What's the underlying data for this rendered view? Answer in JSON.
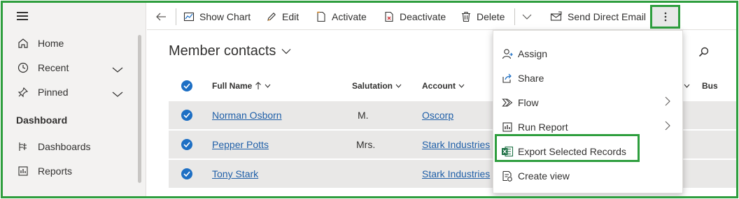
{
  "sidebar": {
    "items": [
      {
        "label": "Home",
        "icon": "home-icon"
      },
      {
        "label": "Recent",
        "icon": "clock-icon"
      },
      {
        "label": "Pinned",
        "icon": "pin-icon"
      }
    ],
    "section_title": "Dashboard",
    "section_items": [
      {
        "label": "Dashboards",
        "icon": "dashboards-icon"
      },
      {
        "label": "Reports",
        "icon": "reports-icon"
      }
    ]
  },
  "toolbar": {
    "show_chart": "Show Chart",
    "edit": "Edit",
    "activate": "Activate",
    "deactivate": "Deactivate",
    "delete": "Delete",
    "send_direct_email": "Send Direct Email"
  },
  "view": {
    "title": "Member contacts"
  },
  "grid": {
    "columns": [
      "Full Name",
      "Salutation",
      "Account",
      "Bus"
    ],
    "rows": [
      {
        "full_name": "Norman Osborn",
        "salutation": "M.",
        "account": "Oscorp"
      },
      {
        "full_name": "Pepper Potts",
        "salutation": "Mrs.",
        "account": "Stark Industries"
      },
      {
        "full_name": "Tony Stark",
        "salutation": "",
        "account": "Stark Industries"
      }
    ]
  },
  "menu": {
    "items": [
      {
        "label": "Assign",
        "icon": "person-icon"
      },
      {
        "label": "Share",
        "icon": "share-icon"
      },
      {
        "label": "Flow",
        "icon": "flow-icon"
      },
      {
        "label": "Run Report",
        "icon": "report-icon"
      },
      {
        "label": "Export Selected Records",
        "icon": "excel-icon"
      },
      {
        "label": "Create view",
        "icon": "create-view-icon"
      }
    ]
  },
  "colors": {
    "accent": "#1d6fc4",
    "highlight": "#2e9e3e",
    "link": "#1f5fa8"
  }
}
